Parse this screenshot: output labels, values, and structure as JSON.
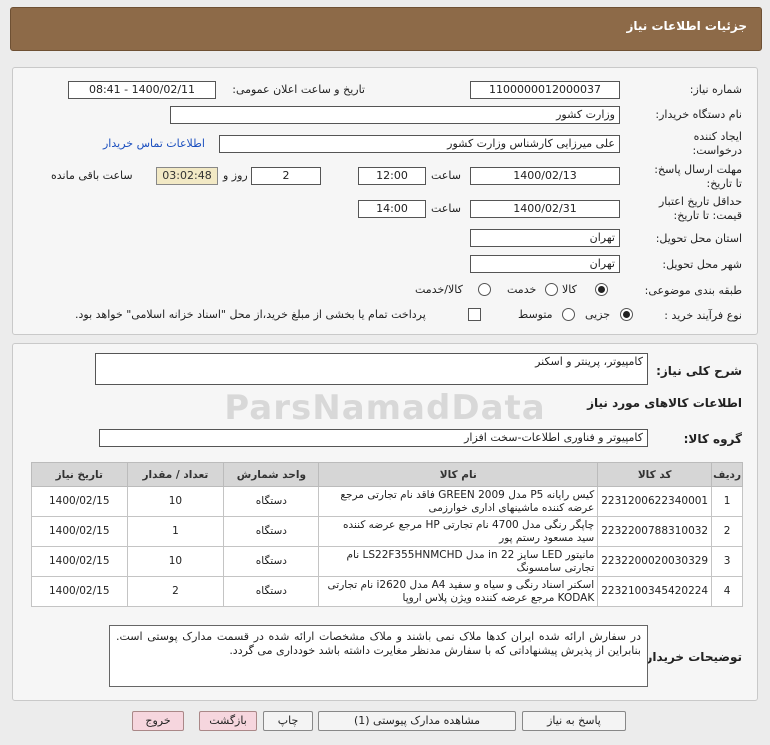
{
  "page_title": "جزئیات اطلاعات نیاز",
  "info": {
    "need_number_label": "شماره نیاز:",
    "need_number": "1100000012000037",
    "announce_label": "تاریخ و ساعت اعلان عمومی:",
    "announce_value": "1400/02/11 - 08:41",
    "buyer_org_label": "نام دستگاه خریدار:",
    "buyer_org": "وزارت کشور",
    "creator_label": "ایجاد کننده درخواست:",
    "creator": "علی میرزایی کارشناس وزارت کشور",
    "contact_link": "اطلاعات تماس خریدار",
    "send_deadline_label": "مهلت ارسال پاسخ: تا تاریخ:",
    "send_date": "1400/02/13",
    "time_label": "ساعت",
    "send_time": "12:00",
    "days_value": "2",
    "days_label": "روز و",
    "remaining_time": "03:02:48",
    "remaining_label": "ساعت باقی مانده",
    "validity_label": "حداقل تاریخ اعتبار قیمت: تا تاریخ:",
    "validity_date": "1400/02/31",
    "validity_time": "14:00",
    "province_label": "استان محل تحویل:",
    "province": "تهران",
    "city_label": "شهر محل تحویل:",
    "city": "تهران",
    "category_label": "طبقه بندی موضوعی:",
    "category_options": [
      "کالا",
      "خدمت",
      "کالا/خدمت"
    ],
    "process_label": "نوع فرآیند خرید :",
    "process_options": [
      "جزیی",
      "متوسط"
    ],
    "payment_note": "پرداخت تمام یا بخشی از مبلغ خرید،از محل \"اسناد خزانه اسلامی\" خواهد بود."
  },
  "summary": {
    "label": "شرح کلی نیاز:",
    "value": "کامپیوتر، پرینتر و اسکنر"
  },
  "goods_section_title": "اطلاعات کالاهای مورد نیاز",
  "group": {
    "label": "گروه کالا:",
    "value": "کامپیوتر و فناوری اطلاعات-سخت افزار"
  },
  "table": {
    "headers": [
      "ردیف",
      "کد کالا",
      "نام کالا",
      "واحد شمارش",
      "تعداد / مقدار",
      "تاریخ نیاز"
    ],
    "rows": [
      {
        "row": "1",
        "code": "2231200622340001",
        "name": "کیس رایانه P5 مدل GREEN 2009 فاقد نام تجارتی مرجع عرضه کننده ماشینهای اداری خوارزمی",
        "unit": "دستگاه",
        "qty": "10",
        "date": "1400/02/15"
      },
      {
        "row": "2",
        "code": "2232200788310032",
        "name": "چاپگر رنگی مدل 4700 نام تجارتی HP مرجع عرضه کننده سید مسعود رستم پور",
        "unit": "دستگاه",
        "qty": "1",
        "date": "1400/02/15"
      },
      {
        "row": "3",
        "code": "2232200020030329",
        "name": "مانیتور LED سایز 22 in مدل LS22F355HNMCHD نام تجارتی سامسونگ",
        "unit": "دستگاه",
        "qty": "10",
        "date": "1400/02/15"
      },
      {
        "row": "4",
        "code": "2232100345420224",
        "name": "اسکنر اسناد رنگی و سیاه و سفید A4 مدل i2620 نام تجارتی KODAK مرجع عرضه کننده ویژن پلاس اروپا",
        "unit": "دستگاه",
        "qty": "2",
        "date": "1400/02/15"
      }
    ]
  },
  "buyer_notes": {
    "label": "توضیحات خریدار:",
    "value": "در سفارش ارائه شده ایران کدها ملاک نمی باشند و ملاک مشخصات ارائه شده در قسمت مدارک پوستی است. بنابراین از پذیرش پیشنهاداتی که با سفارش مدنظر مغایرت داشته باشد خودداری می گردد."
  },
  "buttons": {
    "reply": "پاسخ به نیاز",
    "view_docs": "مشاهده مدارک پیوستی (1)",
    "print": "چاپ",
    "back": "بازگشت",
    "exit": "خروج"
  },
  "watermark": "ParsNamadData"
}
